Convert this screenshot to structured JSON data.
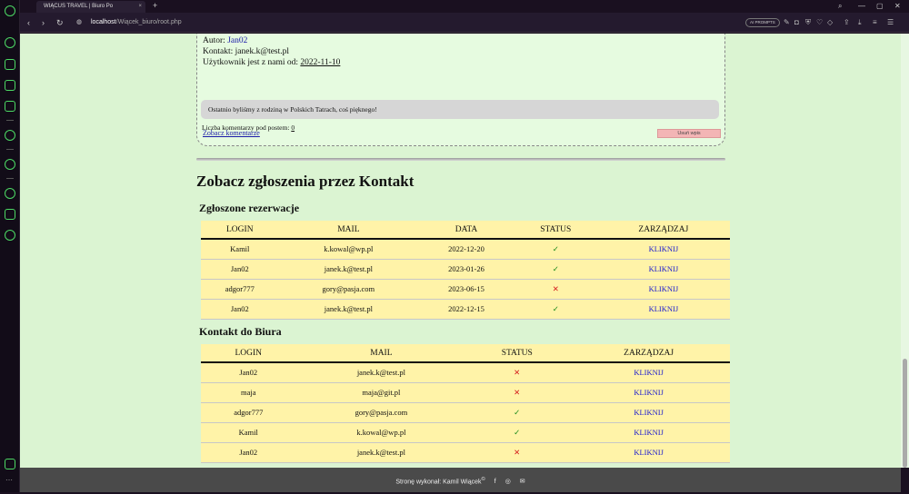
{
  "browser": {
    "tab_title": "WIĄCUS TRAVEL | Biuro Po",
    "url_host": "localhost",
    "url_path": "/Wiącek_biuro/root.php",
    "prompt_label": "AI PROMPTS"
  },
  "post": {
    "author_label": "Autor:",
    "author": "Jan02",
    "contact_label": "Kontakt:",
    "contact": "janek.k@test.pl",
    "member_label": "Użytkownik jest z nami od:",
    "member_since": "2022-11-10",
    "body": "Ostatnio byliśmy z rodziną w Polskich Tatrach, coś pięknego!",
    "see_comments": "Zobacz komentarze",
    "delete_label": "Usuń wpis",
    "comment_count_label": "Liczba komentarzy pod postem:",
    "comment_count": "0"
  },
  "section_title": "Zobacz zgłoszenia przez Kontakt",
  "reservations": {
    "title": "Zgłoszone rezerwacje",
    "headers": [
      "LOGIN",
      "MAIL",
      "DATA",
      "STATUS",
      "ZARZĄDZAJ"
    ],
    "rows": [
      {
        "login": "Kamil",
        "mail": "k.kowal@wp.pl",
        "date": "2022-12-20",
        "status": "✓",
        "action": "KLIKNIJ"
      },
      {
        "login": "Jan02",
        "mail": "janek.k@test.pl",
        "date": "2023-01-26",
        "status": "✓",
        "action": "KLIKNIJ"
      },
      {
        "login": "adgor777",
        "mail": "gory@pasja.com",
        "date": "2023-06-15",
        "status": "✕",
        "action": "KLIKNIJ"
      },
      {
        "login": "Jan02",
        "mail": "janek.k@test.pl",
        "date": "2022-12-15",
        "status": "✓",
        "action": "KLIKNIJ"
      }
    ]
  },
  "contacts": {
    "title": "Kontakt do Biura",
    "headers": [
      "LOGIN",
      "MAIL",
      "STATUS",
      "ZARZĄDZAJ"
    ],
    "rows": [
      {
        "login": "Jan02",
        "mail": "janek.k@test.pl",
        "status": "✕",
        "action": "KLIKNIJ"
      },
      {
        "login": "maja",
        "mail": "maja@git.pl",
        "status": "✕",
        "action": "KLIKNIJ"
      },
      {
        "login": "adgor777",
        "mail": "gory@pasja.com",
        "status": "✓",
        "action": "KLIKNIJ"
      },
      {
        "login": "Kamil",
        "mail": "k.kowal@wp.pl",
        "status": "✓",
        "action": "KLIKNIJ"
      },
      {
        "login": "Jan02",
        "mail": "janek.k@test.pl",
        "status": "✕",
        "action": "KLIKNIJ"
      }
    ]
  },
  "footer": {
    "text": "Stronę wykonał: Kamil Wiącek",
    "copyright": "©"
  },
  "colors": {
    "page_bg": "#dbf4d2",
    "table_bg": "#fff3a8",
    "ok": "#1a8a1a",
    "no": "#d62020",
    "link": "#1a1ad0",
    "footer_bg": "#4a4a4a"
  },
  "icons": [
    "facebook-icon",
    "instagram-icon",
    "mail-icon"
  ]
}
